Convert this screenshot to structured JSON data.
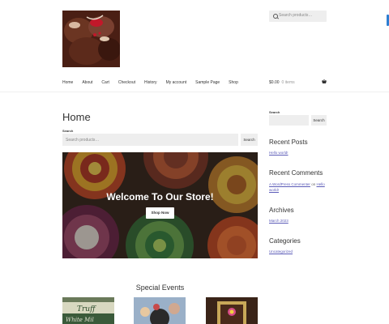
{
  "header": {
    "search_placeholder": "Search products…",
    "logo_alt": "chocolate-logo"
  },
  "nav": {
    "items": [
      "Home",
      "About",
      "Cart",
      "Checkout",
      "History",
      "My account",
      "Sample Page",
      "Shop"
    ]
  },
  "cart": {
    "total": "$0.00",
    "items": "0 items"
  },
  "main": {
    "title": "Home",
    "search_label": "Search",
    "search_placeholder": "Search products…",
    "search_button": "Search",
    "hero_title": "Welcome To Our Store!",
    "hero_button": "Shop Now",
    "events_title": "Special Events"
  },
  "sidebar": {
    "search_label": "Search",
    "search_button": "Search",
    "recent_posts_title": "Recent Posts",
    "recent_posts": [
      "Hello world!"
    ],
    "recent_comments_title": "Recent Comments",
    "comment_author": "A WordPress Commenter",
    "comment_on": "on",
    "comment_post": "Hello world!",
    "archives_title": "Archives",
    "archives": [
      "March 2023"
    ],
    "categories_title": "Categories",
    "categories": [
      "Uncategorized"
    ]
  },
  "colors": {
    "accent": "#2d7fd2",
    "link": "#5c5cb8",
    "field_bg": "#eeeeee"
  }
}
